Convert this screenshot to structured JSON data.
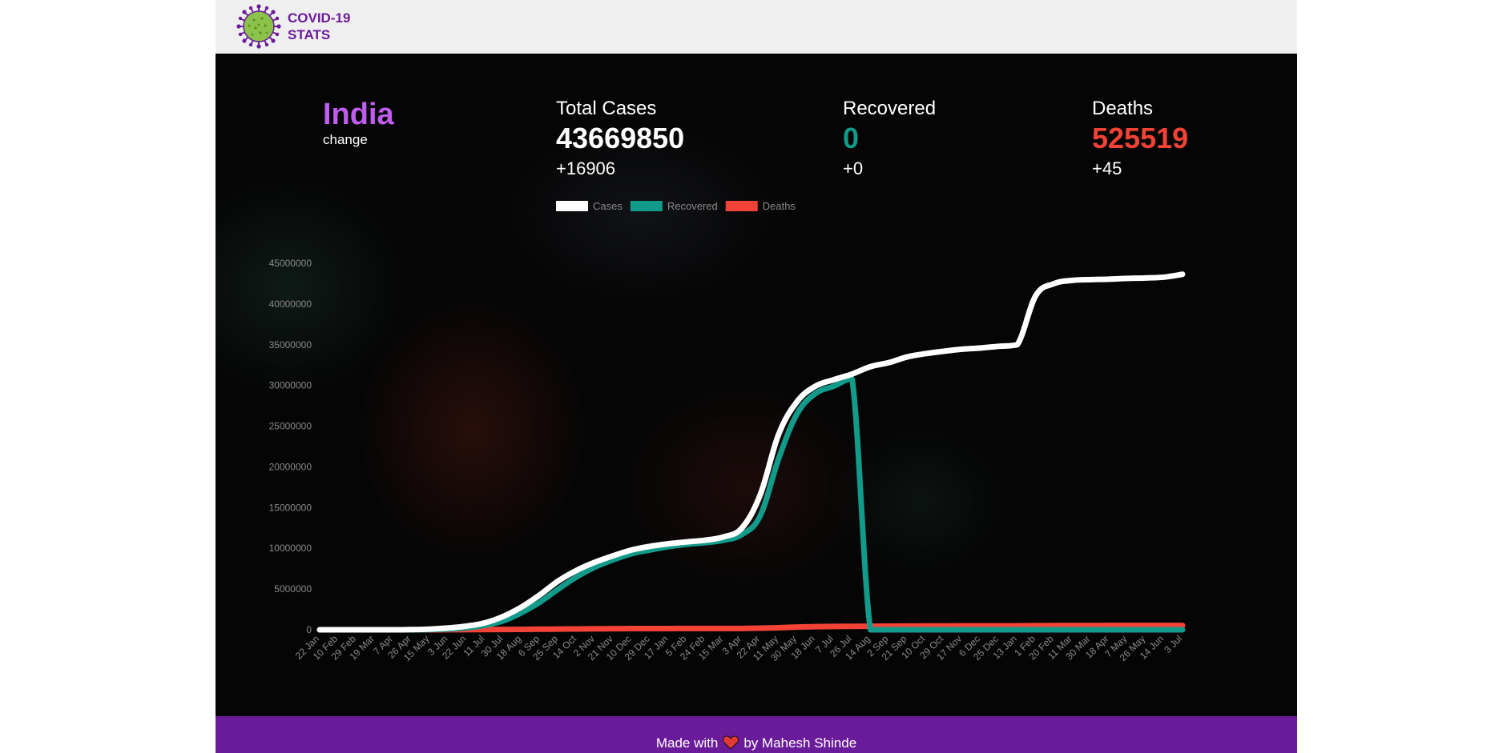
{
  "brand": {
    "line1": "COVID-19",
    "line2": "STATS",
    "logo_icon": "virus-icon"
  },
  "country": {
    "name": "India",
    "change_label": "change"
  },
  "stats": {
    "total": {
      "label": "Total Cases",
      "value": "43669850",
      "delta": "+16906",
      "color": "#ffffff"
    },
    "recovered": {
      "label": "Recovered",
      "value": "0",
      "delta": "+0",
      "color": "#129a8a"
    },
    "deaths": {
      "label": "Deaths",
      "value": "525519",
      "delta": "+45",
      "color": "#f44336"
    }
  },
  "footer": {
    "made_with": "Made with",
    "heart_icon": "heart-icon",
    "by": "by Mahesh Shinde"
  },
  "chart_data": {
    "type": "line",
    "title": "",
    "xlabel": "",
    "ylabel": "",
    "ylim": [
      0,
      45000000
    ],
    "yticks": [
      0,
      5000000,
      10000000,
      15000000,
      20000000,
      25000000,
      30000000,
      35000000,
      40000000,
      45000000
    ],
    "legend_position": "top",
    "grid": false,
    "categories": [
      "22 Jan",
      "10 Feb",
      "29 Feb",
      "19 Mar",
      "7 Apr",
      "26 Apr",
      "15 May",
      "3 Jun",
      "22 Jun",
      "11 Jul",
      "30 Jul",
      "18 Aug",
      "6 Sep",
      "25 Sep",
      "14 Oct",
      "2 Nov",
      "21 Nov",
      "10 Dec",
      "29 Dec",
      "17 Jan",
      "5 Feb",
      "24 Feb",
      "15 Mar",
      "3 Apr",
      "22 Apr",
      "11 May",
      "30 May",
      "18 Jun",
      "7 Jul",
      "26 Jul",
      "14 Aug",
      "2 Sep",
      "21 Sep",
      "10 Oct",
      "29 Oct",
      "17 Nov",
      "6 Dec",
      "25 Dec",
      "13 Jan",
      "1 Feb",
      "20 Feb",
      "11 Mar",
      "30 Mar",
      "18 Apr",
      "7 May",
      "26 May",
      "14 Jun",
      "3 Jul"
    ],
    "series": [
      {
        "name": "Cases",
        "color": "#ffffff",
        "values": [
          0,
          0,
          0,
          0,
          0,
          20000,
          80000,
          220000,
          450000,
          850000,
          1640000,
          2800000,
          4300000,
          6000000,
          7300000,
          8300000,
          9100000,
          9800000,
          10250000,
          10560000,
          10800000,
          11000000,
          11400000,
          12500000,
          16600000,
          24000000,
          28000000,
          29900000,
          30700000,
          31400000,
          32300000,
          32800000,
          33500000,
          33900000,
          34200000,
          34450000,
          34600000,
          34800000,
          35000000,
          41000000,
          42500000,
          42900000,
          43000000,
          43050000,
          43150000,
          43200000,
          43300000,
          43650000
        ]
      },
      {
        "name": "Recovered",
        "color": "#129a8a",
        "values": [
          0,
          0,
          0,
          0,
          0,
          8000,
          30000,
          100000,
          250000,
          550000,
          1100000,
          2100000,
          3400000,
          5000000,
          6500000,
          7700000,
          8600000,
          9350000,
          9800000,
          10200000,
          10500000,
          10700000,
          11000000,
          11700000,
          14000000,
          21000000,
          26500000,
          29000000,
          29900000,
          30800000,
          0,
          0,
          0,
          0,
          0,
          0,
          0,
          0,
          0,
          0,
          0,
          0,
          0,
          0,
          0,
          0,
          0,
          0
        ]
      },
      {
        "name": "Deaths",
        "color": "#f44336",
        "values": [
          0,
          0,
          0,
          0,
          0,
          800,
          3000,
          7000,
          14000,
          25000,
          37000,
          52000,
          68000,
          85000,
          103000,
          121000,
          133000,
          143000,
          148000,
          152000,
          155000,
          157000,
          159000,
          165000,
          200000,
          250000,
          330000,
          380000,
          405000,
          420000,
          435000,
          445000,
          455000,
          462000,
          468000,
          475000,
          478000,
          481000,
          485000,
          498000,
          510000,
          515000,
          521000,
          522000,
          524000,
          524500,
          525000,
          525519
        ]
      }
    ]
  }
}
